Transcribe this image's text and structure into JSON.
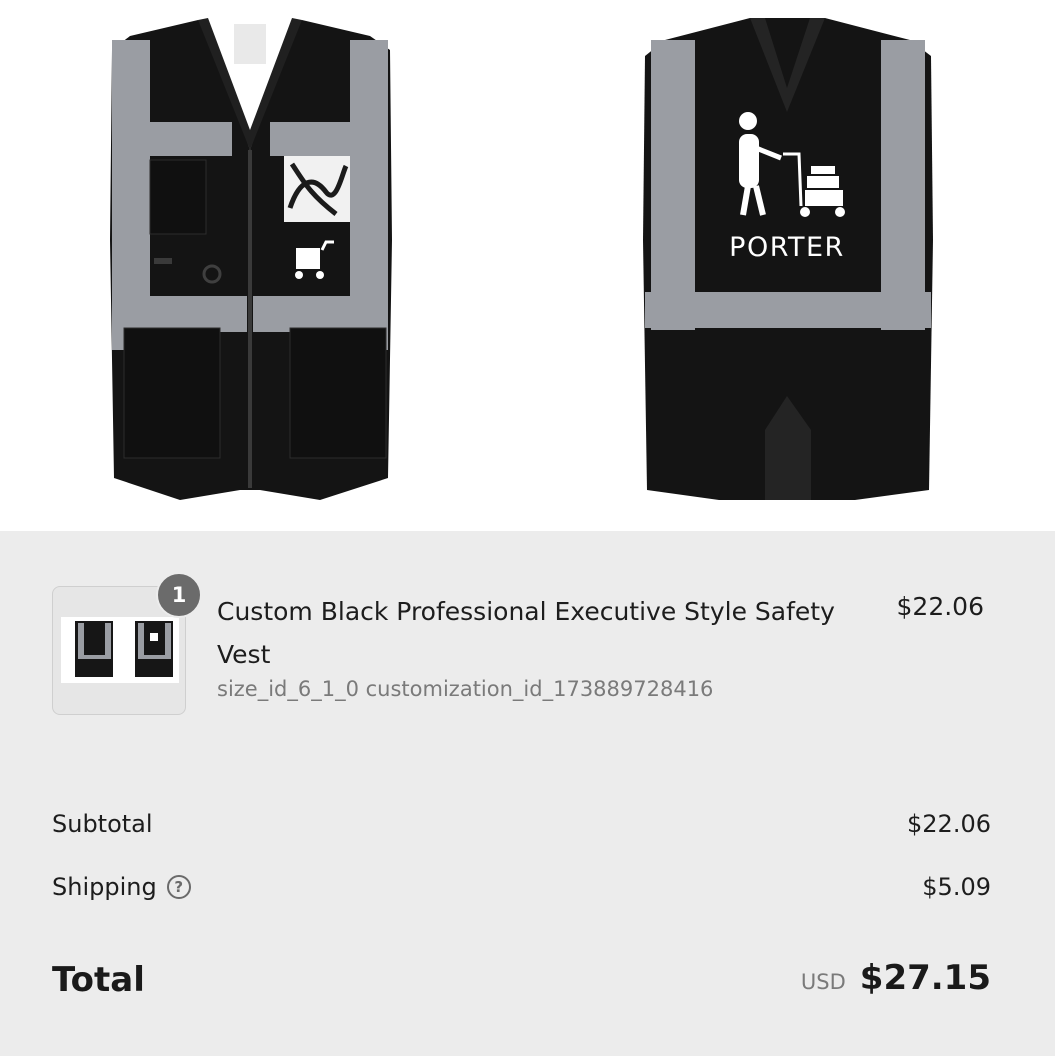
{
  "product_images": {
    "front_alt": "Custom black executive safety vest front",
    "back_alt": "Custom black executive safety vest back",
    "back_print_text": "PORTER"
  },
  "cart_item": {
    "quantity": "1",
    "title": "Custom Black Professional Executive Style Safety Vest",
    "price": "$22.06",
    "meta": "size_id_6_1_0 customization_id_173889728416"
  },
  "totals": {
    "subtotal_label": "Subtotal",
    "subtotal_value": "$22.06",
    "shipping_label": "Shipping",
    "shipping_value": "$5.09",
    "total_label": "Total",
    "currency": "USD",
    "total_value": "$27.15"
  },
  "icons": {
    "help": "question-circle-icon"
  },
  "colors": {
    "vest_black": "#141414",
    "reflective_stripe": "#9a9da3",
    "summary_bg": "#ececec",
    "badge_bg": "#6b6b6b"
  }
}
